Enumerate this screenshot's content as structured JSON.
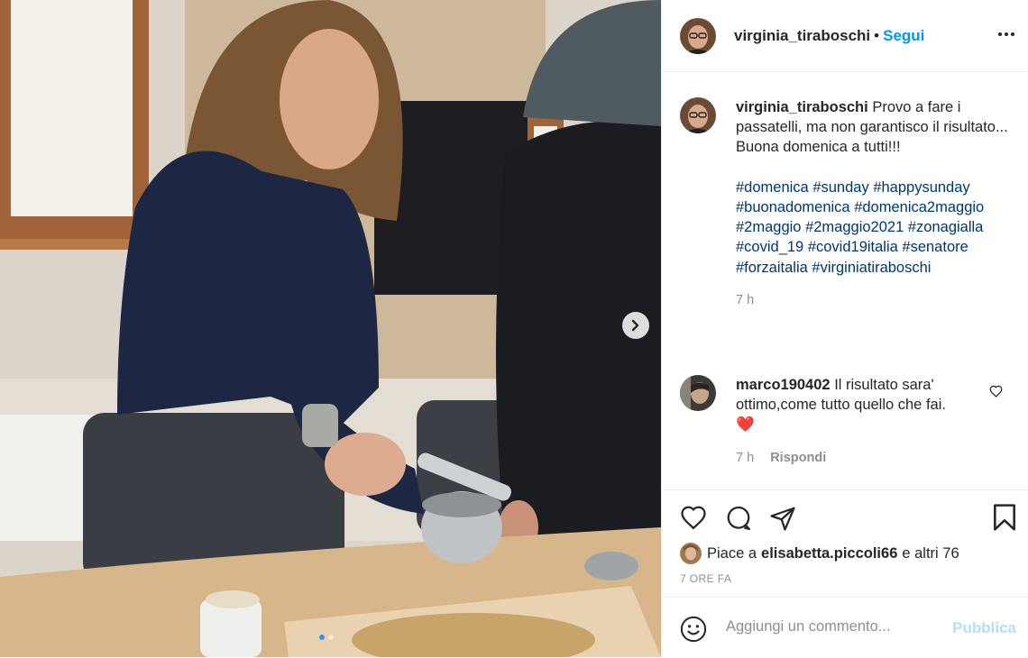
{
  "post": {
    "author": "virginia_tiraboschi",
    "separator": "•",
    "follow_label": "Segui",
    "more_icon": "more-horizontal-icon"
  },
  "caption": {
    "author": "virginia_tiraboschi",
    "line1": "Provo a fare i passatelli, ma non garantisco il risultato...",
    "line2": "Buona domenica a tutti!!!",
    "hashtags": [
      "#domenica",
      "#sunday",
      "#happysunday",
      "#buonadomenica",
      "#domenica2maggio",
      "#2maggio",
      "#2maggio2021",
      "#zonagialla",
      "#covid_19",
      "#covid19italia",
      "#senatore",
      "#forzaitalia",
      "#virginiatiraboschi"
    ],
    "time": "7 h"
  },
  "comment": {
    "author": "marco190402",
    "text": "Il risultato sara' ottimo,come tutto quello che fai.",
    "emoji": "❤️",
    "time": "7 h",
    "reply_label": "Rispondi"
  },
  "likes": {
    "prefix": "Piace a",
    "user": "elisabetta.piccoli66",
    "suffix": "e altri 76"
  },
  "posted_ago": "7 ORE FA",
  "comment_box": {
    "placeholder": "Aggiungi un commento...",
    "publish_label": "Pubblica"
  },
  "carousel": {
    "total": 2,
    "current": 1
  },
  "colors": {
    "link_blue": "#0095f6",
    "hashtag_blue": "#00376b",
    "muted": "#8e8e8e",
    "publish_disabled": "#b2dffc"
  }
}
